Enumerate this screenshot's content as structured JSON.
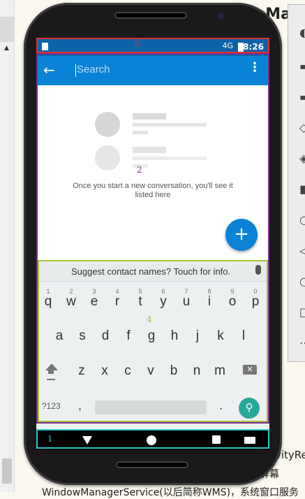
{
  "background": {
    "title_fragment": "Ma",
    "bottom_right_text": "vityRe",
    "bottom_text_2": "显示到屏幕",
    "bottom_text_3": "WindowManagerService(以后简称WMS)，系统窗口服务"
  },
  "status_bar": {
    "signal": "4G",
    "time": "8:26"
  },
  "app_bar": {
    "back_icon": "arrow-back-icon",
    "search_placeholder": "Search",
    "more_icon": "more-vert-icon"
  },
  "empty_state": {
    "message": "Once you start a new conversation, you'll see it listed here"
  },
  "fab": {
    "label": "+"
  },
  "keyboard": {
    "suggestion": "Suggest contact names? Touch for info.",
    "row1": [
      {
        "num": "1",
        "ch": "q"
      },
      {
        "num": "2",
        "ch": "w"
      },
      {
        "num": "3",
        "ch": "e"
      },
      {
        "num": "4",
        "ch": "r"
      },
      {
        "num": "5",
        "ch": "t"
      },
      {
        "num": "6",
        "ch": "y"
      },
      {
        "num": "7",
        "ch": "u"
      },
      {
        "num": "8",
        "ch": "i"
      },
      {
        "num": "9",
        "ch": "o"
      },
      {
        "num": "0",
        "ch": "p"
      }
    ],
    "row2": [
      "a",
      "s",
      "d",
      "f",
      "g",
      "h",
      "j",
      "k",
      "l"
    ],
    "row3": [
      "z",
      "x",
      "c",
      "v",
      "b",
      "n",
      "m"
    ],
    "symbols_label": "?123",
    "comma": ",",
    "period": "."
  },
  "annotations": {
    "box1": "1",
    "box2": "2",
    "box3": "3",
    "box4": "4"
  },
  "colors": {
    "status_bar": "#0d63a8",
    "app_bar": "#0a83d6",
    "fab": "#0a83d6",
    "search_key": "#28a89a"
  }
}
